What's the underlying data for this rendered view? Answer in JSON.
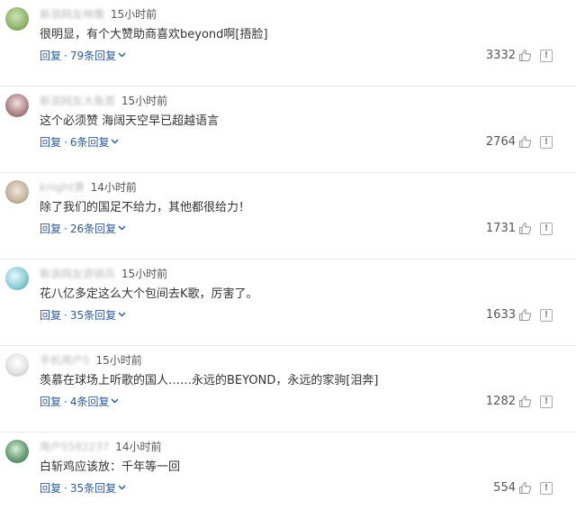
{
  "comments": [
    {
      "username": "新浪网友神鹰",
      "time": "15小时前",
      "text": "很明显，有个大赞助商喜欢beyond啊[捂脸]",
      "reply_label": "回复",
      "reply_count": "79条回复",
      "likes": "3332",
      "avatar_color": "#8fb56a"
    },
    {
      "username": "新浪网友大鱼首",
      "time": "15小时前",
      "text": "这个必须赞 海阔天空早已超越语言",
      "reply_label": "回复",
      "reply_count": "6条回复",
      "likes": "2764",
      "avatar_color": "#b38c8f"
    },
    {
      "username": "knight萧",
      "time": "14小时前",
      "text": "除了我们的国足不给力，其他都很给力！",
      "reply_label": "回复",
      "reply_count": "26条回复",
      "likes": "1731",
      "avatar_color": "#c9b9a5"
    },
    {
      "username": "新浪网友游骑兵",
      "time": "15小时前",
      "text": "花八亿多定这么大个包间去K歌，厉害了。",
      "reply_label": "回复",
      "reply_count": "35条回复",
      "likes": "1633",
      "avatar_color": "#8fcfd9"
    },
    {
      "username": "手机用户5",
      "time": "15小时前",
      "text": "羡慕在球场上听歌的国人……永远的BEYOND，永远的家驹[泪奔]",
      "reply_label": "回复",
      "reply_count": "4条回复",
      "likes": "1282",
      "avatar_color": "#d8d8d8"
    },
    {
      "username": "用户5592237",
      "time": "14小时前",
      "text": "白斩鸡应该放：千年等一回",
      "reply_label": "回复",
      "reply_count": "35条回复",
      "likes": "554",
      "avatar_color": "#6a9f75"
    }
  ]
}
